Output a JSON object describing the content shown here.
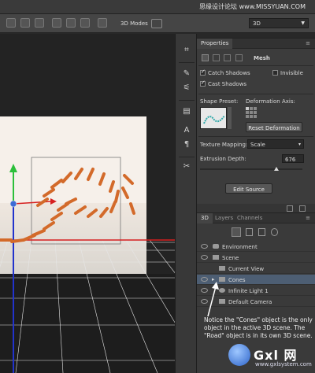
{
  "watermark_top": "思缘设计论坛 www.MISSYUAN.COM",
  "options_bar": {
    "modes_label": "3D Modes",
    "workspace_value": "3D"
  },
  "properties": {
    "tab": "Properties",
    "mode_label": "Mesh",
    "catch_shadows": "Catch Shadows",
    "invisible": "Invisible",
    "cast_shadows": "Cast Shadows",
    "shape_preset": "Shape Preset:",
    "deformation_axis": "Deformation Axis:",
    "reset_deformation": "Reset Deformation",
    "texture_mapping_label": "Texture Mapping:",
    "texture_mapping_value": "Scale",
    "extrusion_depth_label": "Extrusion Depth:",
    "extrusion_depth_value": "676",
    "edit_source": "Edit Source"
  },
  "layers_panel": {
    "tabs": [
      "3D",
      "Layers",
      "Channels"
    ],
    "items": [
      {
        "label": "Environment"
      },
      {
        "label": "Scene"
      },
      {
        "label": "Current View"
      },
      {
        "label": "Cones"
      },
      {
        "label": "Infinite Light 1"
      },
      {
        "label": "Default Camera"
      }
    ]
  },
  "annotation": "Notice the \"Cones\" object is the only object in the active 3D scene. The \"Road\" object is in its own 3D scene.",
  "logo": {
    "text": "Gxl 网",
    "url": "www.gxlsystem.com"
  },
  "colors": {
    "selection": "#4d5e73",
    "axis_x": "#d62020",
    "axis_y": "#2cbf3a",
    "axis_z": "#2233cc",
    "cone": "#d36a2a"
  }
}
